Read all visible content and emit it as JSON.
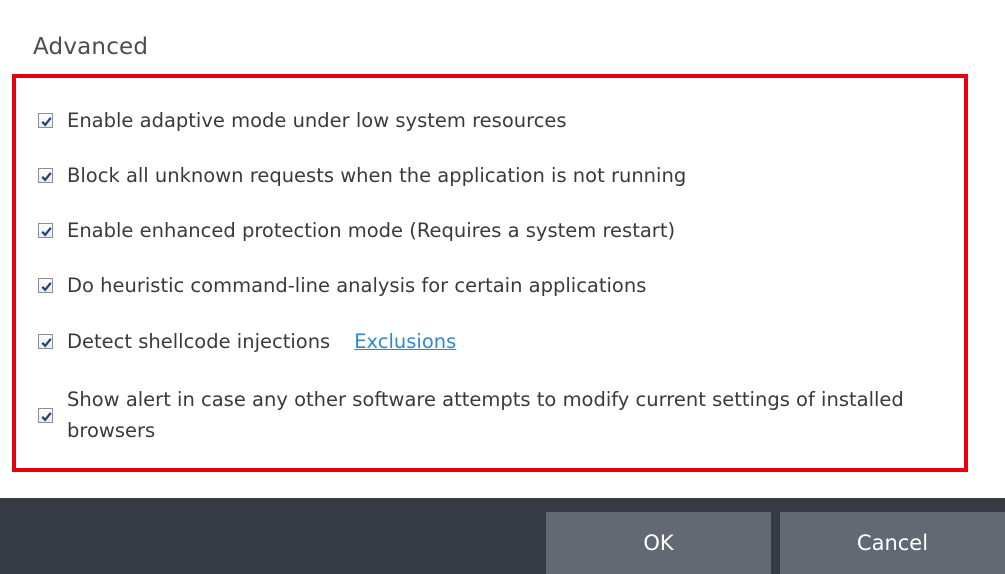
{
  "section": {
    "title": "Advanced"
  },
  "options": [
    {
      "label": "Enable adaptive mode under low system resources",
      "checked": true
    },
    {
      "label": "Block all unknown requests when the application is not running",
      "checked": true
    },
    {
      "label": "Enable enhanced protection mode (Requires a system restart)",
      "checked": true
    },
    {
      "label": "Do heuristic command-line analysis for certain applications",
      "checked": true
    },
    {
      "label": "Detect shellcode injections",
      "checked": true,
      "link": "Exclusions"
    },
    {
      "label": "Show alert in case any other software attempts to modify current settings of installed browsers",
      "checked": true
    }
  ],
  "footer": {
    "ok_label": "OK",
    "cancel_label": "Cancel"
  },
  "colors": {
    "highlight": "#e8000e",
    "footer_bg": "#353a43",
    "button_bg": "#636973",
    "link": "#2a8ad4"
  },
  "icons": {
    "checkbox": "checkmark-icon"
  }
}
